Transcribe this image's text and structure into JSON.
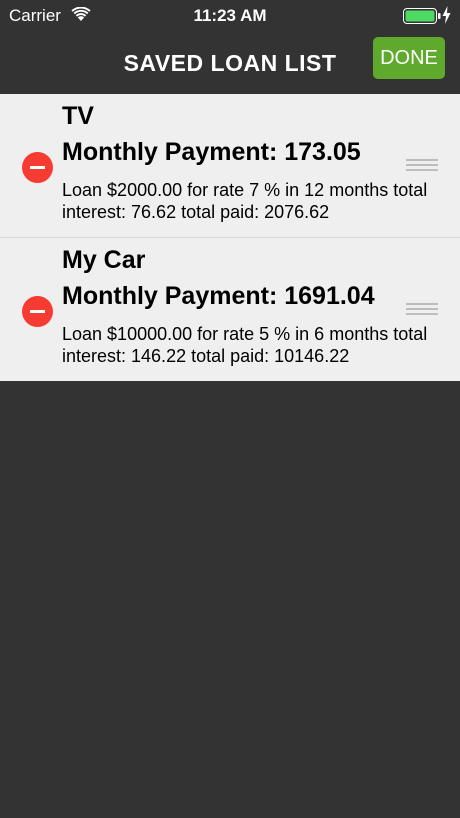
{
  "status_bar": {
    "carrier": "Carrier",
    "time": "11:23 AM",
    "battery_color": "#4cd964"
  },
  "nav": {
    "title": "SAVED LOAN LIST",
    "done_label": "DONE",
    "done_color": "#5faa2c"
  },
  "loans": [
    {
      "name": "TV",
      "monthly_payment": "Monthly Payment: 173.05",
      "details": "Loan $2000.00 for rate 7 % in 12 months total interest: 76.62 total paid: 2076.62"
    },
    {
      "name": "My Car",
      "monthly_payment": "Monthly Payment: 1691.04",
      "details": "Loan $10000.00 for rate 5 % in 6 months total interest: 146.22 total paid: 10146.22"
    }
  ],
  "icons": {
    "wifi": "wifi-icon",
    "battery": "battery-icon",
    "charge": "charging-bolt-icon",
    "delete": "delete-minus-icon",
    "reorder": "reorder-handle-icon"
  },
  "colors": {
    "background": "#333333",
    "list_background": "#efefef",
    "delete": "#f63b33"
  }
}
